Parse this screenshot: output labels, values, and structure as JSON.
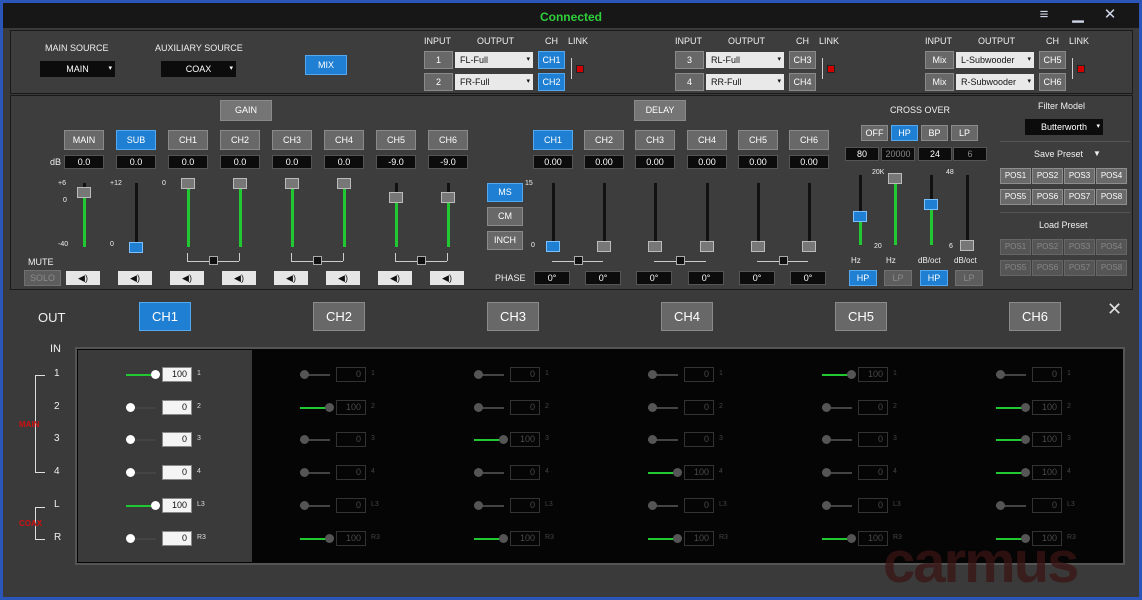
{
  "window": {
    "status": "Connected",
    "menu_icon": "hamburger-icon",
    "minimize_icon": "minimize-icon",
    "close_icon": "close-icon"
  },
  "source": {
    "main_label": "MAIN SOURCE",
    "main_value": "MAIN",
    "aux_label": "AUXILIARY SOURCE",
    "aux_value": "COAX",
    "mix_button": "MIX"
  },
  "io_headers": {
    "input": "INPUT",
    "output": "OUTPUT",
    "ch": "CH",
    "link": "LINK"
  },
  "io_groups": [
    {
      "rows": [
        {
          "input": "1",
          "output": "FL-Full",
          "ch": "CH1"
        },
        {
          "input": "2",
          "output": "FR-Full",
          "ch": "CH2"
        }
      ]
    },
    {
      "rows": [
        {
          "input": "3",
          "output": "RL-Full",
          "ch": "CH3"
        },
        {
          "input": "4",
          "output": "RR-Full",
          "ch": "CH4"
        }
      ]
    },
    {
      "rows": [
        {
          "input": "Mix",
          "output": "L-Subwooder",
          "ch": "CH5"
        },
        {
          "input": "Mix",
          "output": "R-Subwooder",
          "ch": "CH6"
        }
      ]
    }
  ],
  "gain": {
    "button": "GAIN",
    "db_label": "dB",
    "mute_label": "MUTE",
    "solo_label": "SOLO",
    "speaker_icon": "speaker-icon",
    "channels": [
      {
        "name": "MAIN",
        "value": "0.0",
        "scale_top": "+6",
        "scale_mid": "0",
        "scale_bot": "-40",
        "level": 0.86,
        "active": false
      },
      {
        "name": "SUB",
        "value": "0.0",
        "scale_top": "+12",
        "scale_mid": "",
        "scale_bot": "0",
        "level": 0.0,
        "active": true
      },
      {
        "name": "CH1",
        "value": "0.0",
        "scale_top": "0",
        "scale_mid": "",
        "scale_bot": "",
        "level": 1.0,
        "active": false
      },
      {
        "name": "CH2",
        "value": "0.0",
        "scale_top": "",
        "scale_mid": "",
        "scale_bot": "",
        "level": 1.0,
        "active": false
      },
      {
        "name": "CH3",
        "value": "0.0",
        "scale_top": "",
        "scale_mid": "",
        "scale_bot": "",
        "level": 1.0,
        "active": false
      },
      {
        "name": "CH4",
        "value": "0.0",
        "scale_top": "",
        "scale_mid": "",
        "scale_bot": "",
        "level": 1.0,
        "active": false
      },
      {
        "name": "CH5",
        "value": "-9.0",
        "scale_top": "",
        "scale_mid": "",
        "scale_bot": "",
        "level": 0.78,
        "active": false
      },
      {
        "name": "CH6",
        "value": "-9.0",
        "scale_top": "",
        "scale_mid": "",
        "scale_bot": "",
        "level": 0.78,
        "active": false
      }
    ]
  },
  "delay": {
    "button": "DELAY",
    "units": [
      "MS",
      "CM",
      "INCH"
    ],
    "scale_top": "15",
    "scale_bot": "0",
    "phase_label": "PHASE",
    "channels": [
      {
        "name": "CH1",
        "value": "0.00",
        "phase": "0°",
        "active": true
      },
      {
        "name": "CH2",
        "value": "0.00",
        "phase": "0°",
        "active": false
      },
      {
        "name": "CH3",
        "value": "0.00",
        "phase": "0°",
        "active": false
      },
      {
        "name": "CH4",
        "value": "0.00",
        "phase": "0°",
        "active": false
      },
      {
        "name": "CH5",
        "value": "0.00",
        "phase": "0°",
        "active": false
      },
      {
        "name": "CH6",
        "value": "0.00",
        "phase": "0°",
        "active": false
      }
    ]
  },
  "crossover": {
    "title": "CROSS OVER",
    "modes": [
      "OFF",
      "HP",
      "BP",
      "LP"
    ],
    "active_mode": "HP",
    "values": [
      "80",
      "20000",
      "24",
      "6"
    ],
    "scale_20k": "20K",
    "scale_20": "20",
    "scale_48": "48",
    "scale_6": "6",
    "labels": [
      "Hz",
      "Hz",
      "dB/oct",
      "dB/oct"
    ],
    "hp_button": "HP",
    "lp_button": "LP"
  },
  "presets": {
    "filter_model_label": "Filter Model",
    "filter_model_value": "Butterworth",
    "save_label": "Save Preset",
    "load_label": "Load Preset",
    "slots": [
      "POS1",
      "POS2",
      "POS3",
      "POS4",
      "POS5",
      "POS6",
      "POS7",
      "POS8"
    ]
  },
  "mixer": {
    "out_label": "OUT",
    "in_label": "IN",
    "outputs": [
      "CH1",
      "CH2",
      "CH3",
      "CH4",
      "CH5",
      "CH6"
    ],
    "active_output": "CH1",
    "group_main": "MAIN",
    "group_coax": "COAX",
    "inputs": [
      "1",
      "2",
      "3",
      "4",
      "L",
      "R"
    ],
    "input_tags": [
      "1",
      "2",
      "3",
      "4",
      "L3",
      "R3"
    ],
    "matrix": [
      [
        {
          "v": "100",
          "on": true
        },
        {
          "v": "0",
          "on": false
        },
        {
          "v": "0",
          "on": false
        },
        {
          "v": "0",
          "on": false
        },
        {
          "v": "100",
          "on": true
        },
        {
          "v": "0",
          "on": false
        }
      ],
      [
        {
          "v": "0",
          "on": false
        },
        {
          "v": "100",
          "on": true
        },
        {
          "v": "0",
          "on": false
        },
        {
          "v": "0",
          "on": false
        },
        {
          "v": "0",
          "on": false
        },
        {
          "v": "100",
          "on": true
        }
      ],
      [
        {
          "v": "0",
          "on": false
        },
        {
          "v": "0",
          "on": false
        },
        {
          "v": "100",
          "on": true
        },
        {
          "v": "0",
          "on": false
        },
        {
          "v": "0",
          "on": false
        },
        {
          "v": "100",
          "on": true
        }
      ],
      [
        {
          "v": "0",
          "on": false
        },
        {
          "v": "0",
          "on": false
        },
        {
          "v": "0",
          "on": false
        },
        {
          "v": "100",
          "on": true
        },
        {
          "v": "0",
          "on": false
        },
        {
          "v": "100",
          "on": true
        }
      ],
      [
        {
          "v": "100",
          "on": true
        },
        {
          "v": "0",
          "on": false
        },
        {
          "v": "0",
          "on": false
        },
        {
          "v": "0",
          "on": false
        },
        {
          "v": "0",
          "on": false
        },
        {
          "v": "100",
          "on": true
        }
      ],
      [
        {
          "v": "0",
          "on": false
        },
        {
          "v": "100",
          "on": true
        },
        {
          "v": "100",
          "on": true
        },
        {
          "v": "100",
          "on": true
        },
        {
          "v": "0",
          "on": false
        },
        {
          "v": "100",
          "on": true
        }
      ]
    ],
    "close_icon": "close-icon"
  },
  "watermark": "carmus"
}
